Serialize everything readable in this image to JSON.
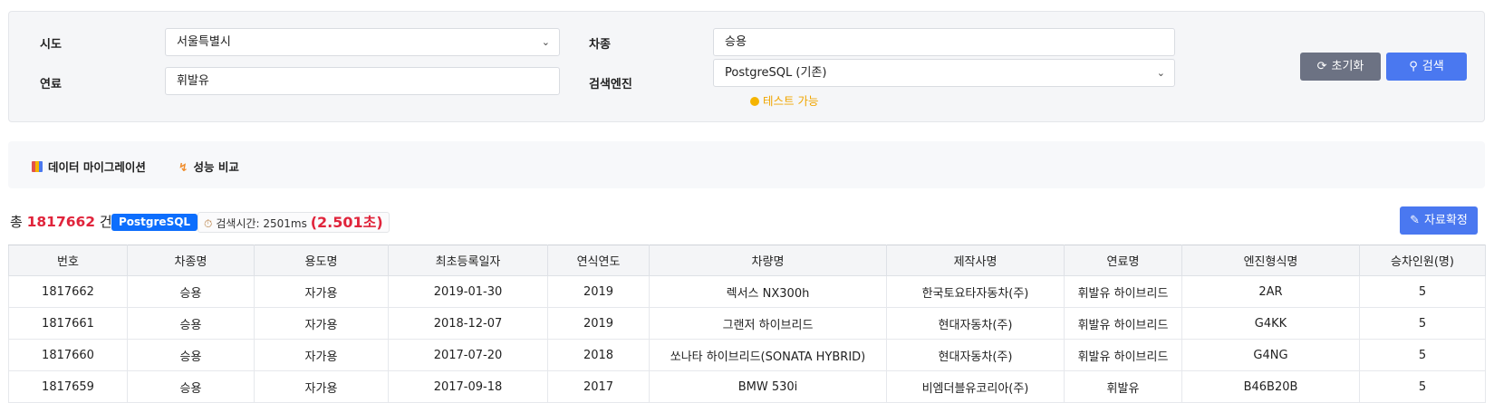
{
  "filters": {
    "sido_label": "시도",
    "sido_value": "서울특별시",
    "vehicle_type_label": "차종",
    "vehicle_type_value": "승용",
    "fuel_label": "연료",
    "fuel_value": "휘발유",
    "engine_label": "검색엔진",
    "engine_value": "PostgreSQL (기존)",
    "engine_hint": "테스트 가능",
    "reset_label": "초기화",
    "search_label": "검색"
  },
  "tabs": {
    "migration_label": "데이터 마이그레이션",
    "perf_label": "성능 비교"
  },
  "summary": {
    "prefix": "총",
    "count": "1817662",
    "suffix": "건",
    "engine_badge": "PostgreSQL",
    "time_label": "검색시간: 2501ms",
    "time_seconds": "(2.501초)",
    "confirm_label": "자료확정"
  },
  "table": {
    "headers": [
      "번호",
      "차종명",
      "용도명",
      "최초등록일자",
      "연식연도",
      "차량명",
      "제작사명",
      "연료명",
      "엔진형식명",
      "승차인원(명)"
    ],
    "rows": [
      [
        "1817662",
        "승용",
        "자가용",
        "2019-01-30",
        "2019",
        "렉서스 NX300h",
        "한국토요타자동차(주)",
        "휘발유 하이브리드",
        "2AR",
        "5"
      ],
      [
        "1817661",
        "승용",
        "자가용",
        "2018-12-07",
        "2019",
        "그랜저 하이브리드",
        "현대자동차(주)",
        "휘발유 하이브리드",
        "G4KK",
        "5"
      ],
      [
        "1817660",
        "승용",
        "자가용",
        "2017-07-20",
        "2018",
        "쏘나타 하이브리드(SONATA HYBRID)",
        "현대자동차(주)",
        "휘발유 하이브리드",
        "G4NG",
        "5"
      ],
      [
        "1817659",
        "승용",
        "자가용",
        "2017-09-18",
        "2017",
        "BMW 530i",
        "비엠더블유코리아(주)",
        "휘발유",
        "B46B20B",
        "5"
      ]
    ]
  },
  "colors": {
    "accent": "#4a78f0",
    "badge": "#0d6efd",
    "count": "#e0243b",
    "hint": "#f0a500",
    "reset": "#6c7283"
  }
}
